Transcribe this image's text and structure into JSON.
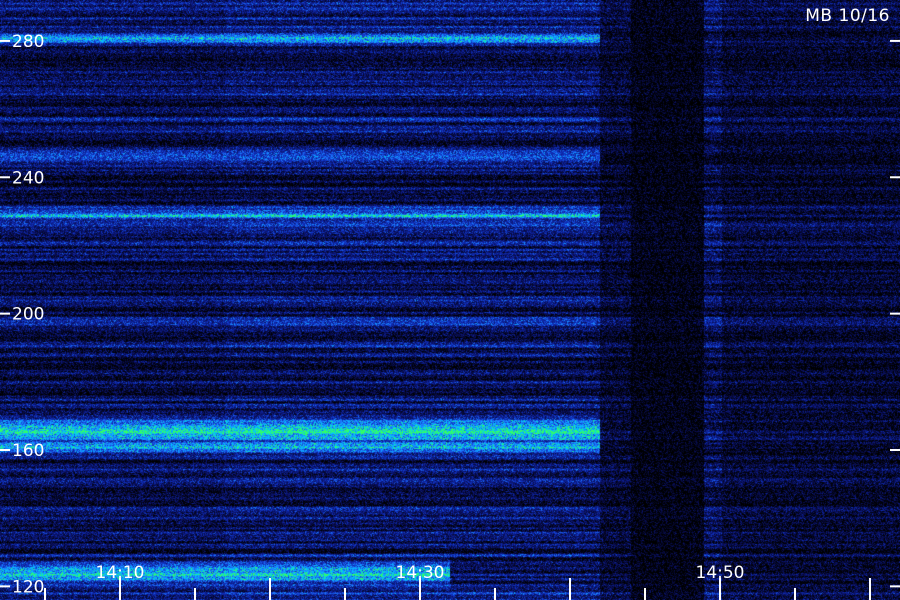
{
  "chart_data": {
    "type": "heatmap",
    "corner_label": "MB 10/16",
    "y_ticks": [
      120,
      160,
      200,
      240,
      280
    ],
    "y_range": [
      116,
      292
    ],
    "x_tick_labels": [
      {
        "label": "14:10",
        "minute": 10
      },
      {
        "label": "14:30",
        "minute": 30
      },
      {
        "label": "14:50",
        "minute": 50
      }
    ],
    "x_range_minutes": [
      2,
      62
    ],
    "minor_tick_step_minutes": 5,
    "colormap": [
      "#000000",
      "#0a1060",
      "#1030c0",
      "#1e78ff",
      "#00c8ff",
      "#32ff64"
    ],
    "bright_bands": [
      {
        "center": 166,
        "width": 3,
        "strength": 1.0,
        "end_minute": 42
      },
      {
        "center": 161,
        "width": 2,
        "strength": 0.85,
        "end_minute": 42
      },
      {
        "center": 124,
        "width": 3,
        "strength": 0.9,
        "end_minute": 32
      },
      {
        "center": 281,
        "width": 1.5,
        "strength": 0.8,
        "end_minute": 42
      },
      {
        "center": 229,
        "width": 1.5,
        "strength": 0.7,
        "end_minute": 42
      },
      {
        "center": 246,
        "width": 2,
        "strength": 0.6,
        "end_minute": 42
      }
    ],
    "quiet_interval_minutes": [
      44,
      49
    ]
  }
}
